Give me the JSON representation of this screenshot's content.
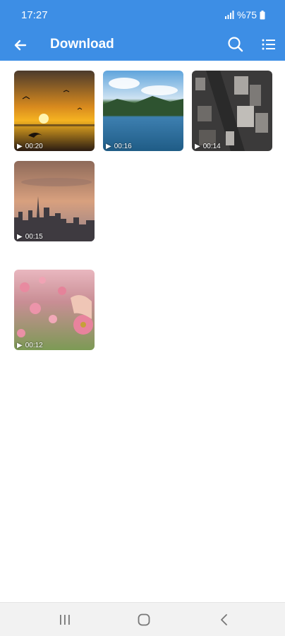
{
  "status": {
    "time": "17:27",
    "battery": "%75"
  },
  "appbar": {
    "title": "Download"
  },
  "videos": [
    {
      "duration": "00:20",
      "scene": "sunset over sea with birds"
    },
    {
      "duration": "00:16",
      "scene": "mountain lake"
    },
    {
      "duration": "00:14",
      "scene": "city aerial"
    },
    {
      "duration": "00:15",
      "scene": "city skyline at dusk"
    },
    {
      "duration": "00:12",
      "scene": "pink cosmos flowers"
    }
  ],
  "icons": {
    "back": "arrow-left-icon",
    "search": "search-icon",
    "menu": "list-view-icon",
    "recents": "recents-icon",
    "home": "home-icon",
    "nav_back": "chevron-left-icon"
  }
}
